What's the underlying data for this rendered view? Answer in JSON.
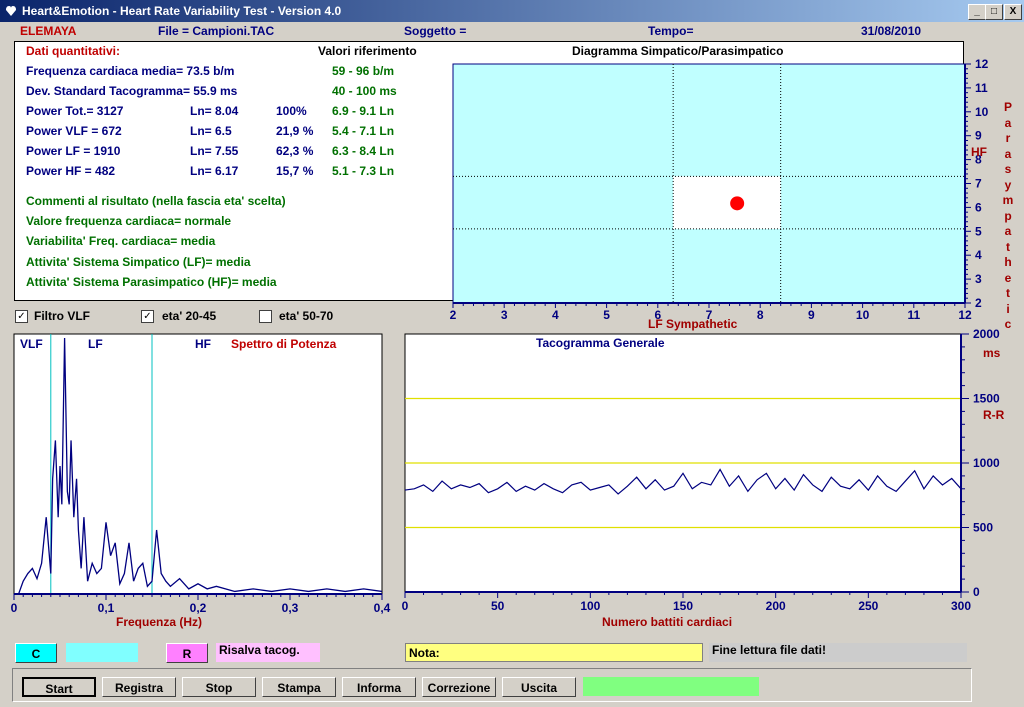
{
  "window": {
    "title": "Heart&Emotion - Heart Rate Variability Test - Version 4.0",
    "minimize": "_",
    "maximize": "□",
    "close": "X"
  },
  "header": {
    "brand": "ELEMAYA",
    "file": "File = Campioni.TAC",
    "subject": "Soggetto =",
    "time": "Tempo=",
    "date": "31/08/2010"
  },
  "quant": {
    "heading": "Dati quantitativi:",
    "ref_heading": "Valori riferimento",
    "fc": "Frequenza cardiaca media= 73.5 b/m",
    "fc_ref": "59 - 96 b/m",
    "dev": "Dev. Standard Tacogramma= 55.9 ms",
    "dev_ref": "40 - 100 ms",
    "rows": [
      {
        "label": "Power Tot.= 3127",
        "ln": "Ln= 8.04",
        "pct": "100%",
        "ref": "6.9 - 9.1 Ln"
      },
      {
        "label": "Power VLF = 672",
        "ln": "Ln= 6.5",
        "pct": "21,9 %",
        "ref": "5.4 - 7.1 Ln"
      },
      {
        "label": "Power  LF  = 1910",
        "ln": "Ln= 7.55",
        "pct": "62,3 %",
        "ref": "6.3 - 8.4 Ln"
      },
      {
        "label": "Power  HF  = 482",
        "ln": "Ln= 6.17",
        "pct": "15,7 %",
        "ref": "5.1 - 7.3 Ln"
      }
    ],
    "comments": [
      "Commenti al risultato (nella fascia eta' scelta)",
      "Valore frequenza cardiaca= normale",
      "Variabilita' Freq. cardiaca= media",
      "Attivita' Sistema Simpatico (LF)= media",
      "Attivita' Sistema Parasimpatico (HF)= media"
    ]
  },
  "diagram": {
    "title": "Diagramma Simpatico/Parasimpatico",
    "xlabel": "LF Sympathetic",
    "hf_label": "HF",
    "side_label": [
      "P",
      "a",
      "r",
      "a",
      "s",
      "y",
      "m",
      "p",
      "a",
      "t",
      "h",
      "e",
      "t",
      "i",
      "c"
    ],
    "x_ticks": [
      "2",
      "3",
      "4",
      "5",
      "6",
      "7",
      "8",
      "9",
      "10",
      "11",
      "12"
    ],
    "y_ticks": [
      "12",
      "11",
      "10",
      "9",
      "8",
      "7",
      "6",
      "5",
      "4",
      "3",
      "2"
    ]
  },
  "options": {
    "vlf_filter": "Filtro VLF",
    "age1": "eta' 20-45",
    "age2": "eta' 50-70",
    "vlf_filter_checked": "✓",
    "age1_checked": "✓"
  },
  "spectrum": {
    "vlf": "VLF",
    "lf": "LF",
    "hf": "HF",
    "title": "Spettro di Potenza",
    "xlabel": "Frequenza (Hz)",
    "x_ticks": [
      "0",
      "0,1",
      "0,2",
      "0,3",
      "0,4"
    ]
  },
  "tacogram": {
    "title": "Tacogramma Generale",
    "xlabel": "Numero battiti cardiaci",
    "unit": "ms",
    "rr": "R-R",
    "x_ticks": [
      "0",
      "50",
      "100",
      "150",
      "200",
      "250",
      "300"
    ],
    "y_ticks": [
      "2000",
      "1500",
      "1000",
      "500",
      "0"
    ]
  },
  "bottom": {
    "c_label": "C",
    "r_label": "R",
    "save_tacog": "Risalva tacog.",
    "note": "Nota:",
    "status": "Fine lettura file dati!",
    "buttons": [
      "Start",
      "Registra",
      "Stop",
      "Stampa",
      "Informa",
      "Correzione",
      "Uscita"
    ]
  },
  "chart_data": [
    {
      "type": "scatter",
      "title": "Diagramma Simpatico/Parasimpatico",
      "xlabel": "LF Sympathetic",
      "ylabel": "HF",
      "xlim": [
        2,
        12
      ],
      "ylim": [
        2,
        12
      ],
      "x": [
        7.55
      ],
      "y": [
        6.17
      ],
      "reference_box": {
        "lf": [
          6.3,
          8.4
        ],
        "hf": [
          5.1,
          7.3
        ]
      },
      "colors": {
        "background": "#c0ffff",
        "box": "#ffffff",
        "point": "#ff0000"
      }
    },
    {
      "type": "line",
      "title": "Spettro di Potenza",
      "xlabel": "Frequenza (Hz)",
      "xlim": [
        0,
        0.4
      ],
      "band_limits": [
        0.04,
        0.15
      ],
      "x": [
        0,
        0.005,
        0.01,
        0.015,
        0.02,
        0.025,
        0.03,
        0.035,
        0.04,
        0.042,
        0.045,
        0.048,
        0.05,
        0.052,
        0.055,
        0.058,
        0.06,
        0.062,
        0.065,
        0.068,
        0.07,
        0.073,
        0.076,
        0.08,
        0.085,
        0.09,
        0.095,
        0.1,
        0.105,
        0.11,
        0.115,
        0.12,
        0.125,
        0.13,
        0.135,
        0.14,
        0.145,
        0.15,
        0.155,
        0.16,
        0.165,
        0.17,
        0.18,
        0.19,
        0.2,
        0.21,
        0.22,
        0.24,
        0.26,
        0.28,
        0.3,
        0.32,
        0.34,
        0.36,
        0.38,
        0.4
      ],
      "y": [
        0,
        0,
        0.05,
        0.08,
        0.1,
        0.06,
        0.12,
        0.3,
        0.08,
        0.45,
        0.6,
        0.3,
        0.5,
        0.35,
        1,
        0.4,
        0.35,
        0.6,
        0.3,
        0.45,
        0.25,
        0.1,
        0.3,
        0.05,
        0.12,
        0.08,
        0.1,
        0.28,
        0.15,
        0.2,
        0.04,
        0.08,
        0.2,
        0.05,
        0.1,
        0.12,
        0.03,
        0.05,
        0.25,
        0.08,
        0.05,
        0.03,
        0.06,
        0.02,
        0.04,
        0.02,
        0.03,
        0.01,
        0.02,
        0.01,
        0.02,
        0.01,
        0.02,
        0.01,
        0.02,
        0.01
      ],
      "color": "#000080"
    },
    {
      "type": "line",
      "title": "Tacogramma Generale",
      "xlabel": "Numero battiti cardiaci",
      "ylabel": "R-R (ms)",
      "xlim": [
        0,
        300
      ],
      "ylim": [
        0,
        2000
      ],
      "reference_lines": [
        1500,
        1000,
        500
      ],
      "x": [
        0,
        5,
        10,
        15,
        20,
        25,
        30,
        35,
        40,
        45,
        50,
        55,
        60,
        65,
        70,
        75,
        80,
        85,
        90,
        95,
        100,
        105,
        110,
        115,
        120,
        125,
        130,
        135,
        140,
        145,
        150,
        155,
        160,
        165,
        170,
        175,
        180,
        185,
        190,
        195,
        200,
        205,
        210,
        215,
        220,
        225,
        230,
        235,
        240,
        245,
        250,
        255,
        260,
        265,
        270,
        275,
        280,
        285,
        290,
        295,
        300
      ],
      "y": [
        790,
        800,
        830,
        780,
        860,
        800,
        830,
        810,
        840,
        770,
        800,
        850,
        780,
        820,
        790,
        840,
        800,
        770,
        830,
        850,
        790,
        810,
        830,
        760,
        820,
        890,
        800,
        870,
        790,
        820,
        920,
        800,
        850,
        830,
        950,
        820,
        900,
        780,
        870,
        920,
        800,
        880,
        790,
        910,
        830,
        780,
        890,
        820,
        800,
        870,
        790,
        900,
        820,
        780,
        860,
        940,
        800,
        900,
        830,
        880,
        800
      ],
      "color": "#000080"
    }
  ]
}
